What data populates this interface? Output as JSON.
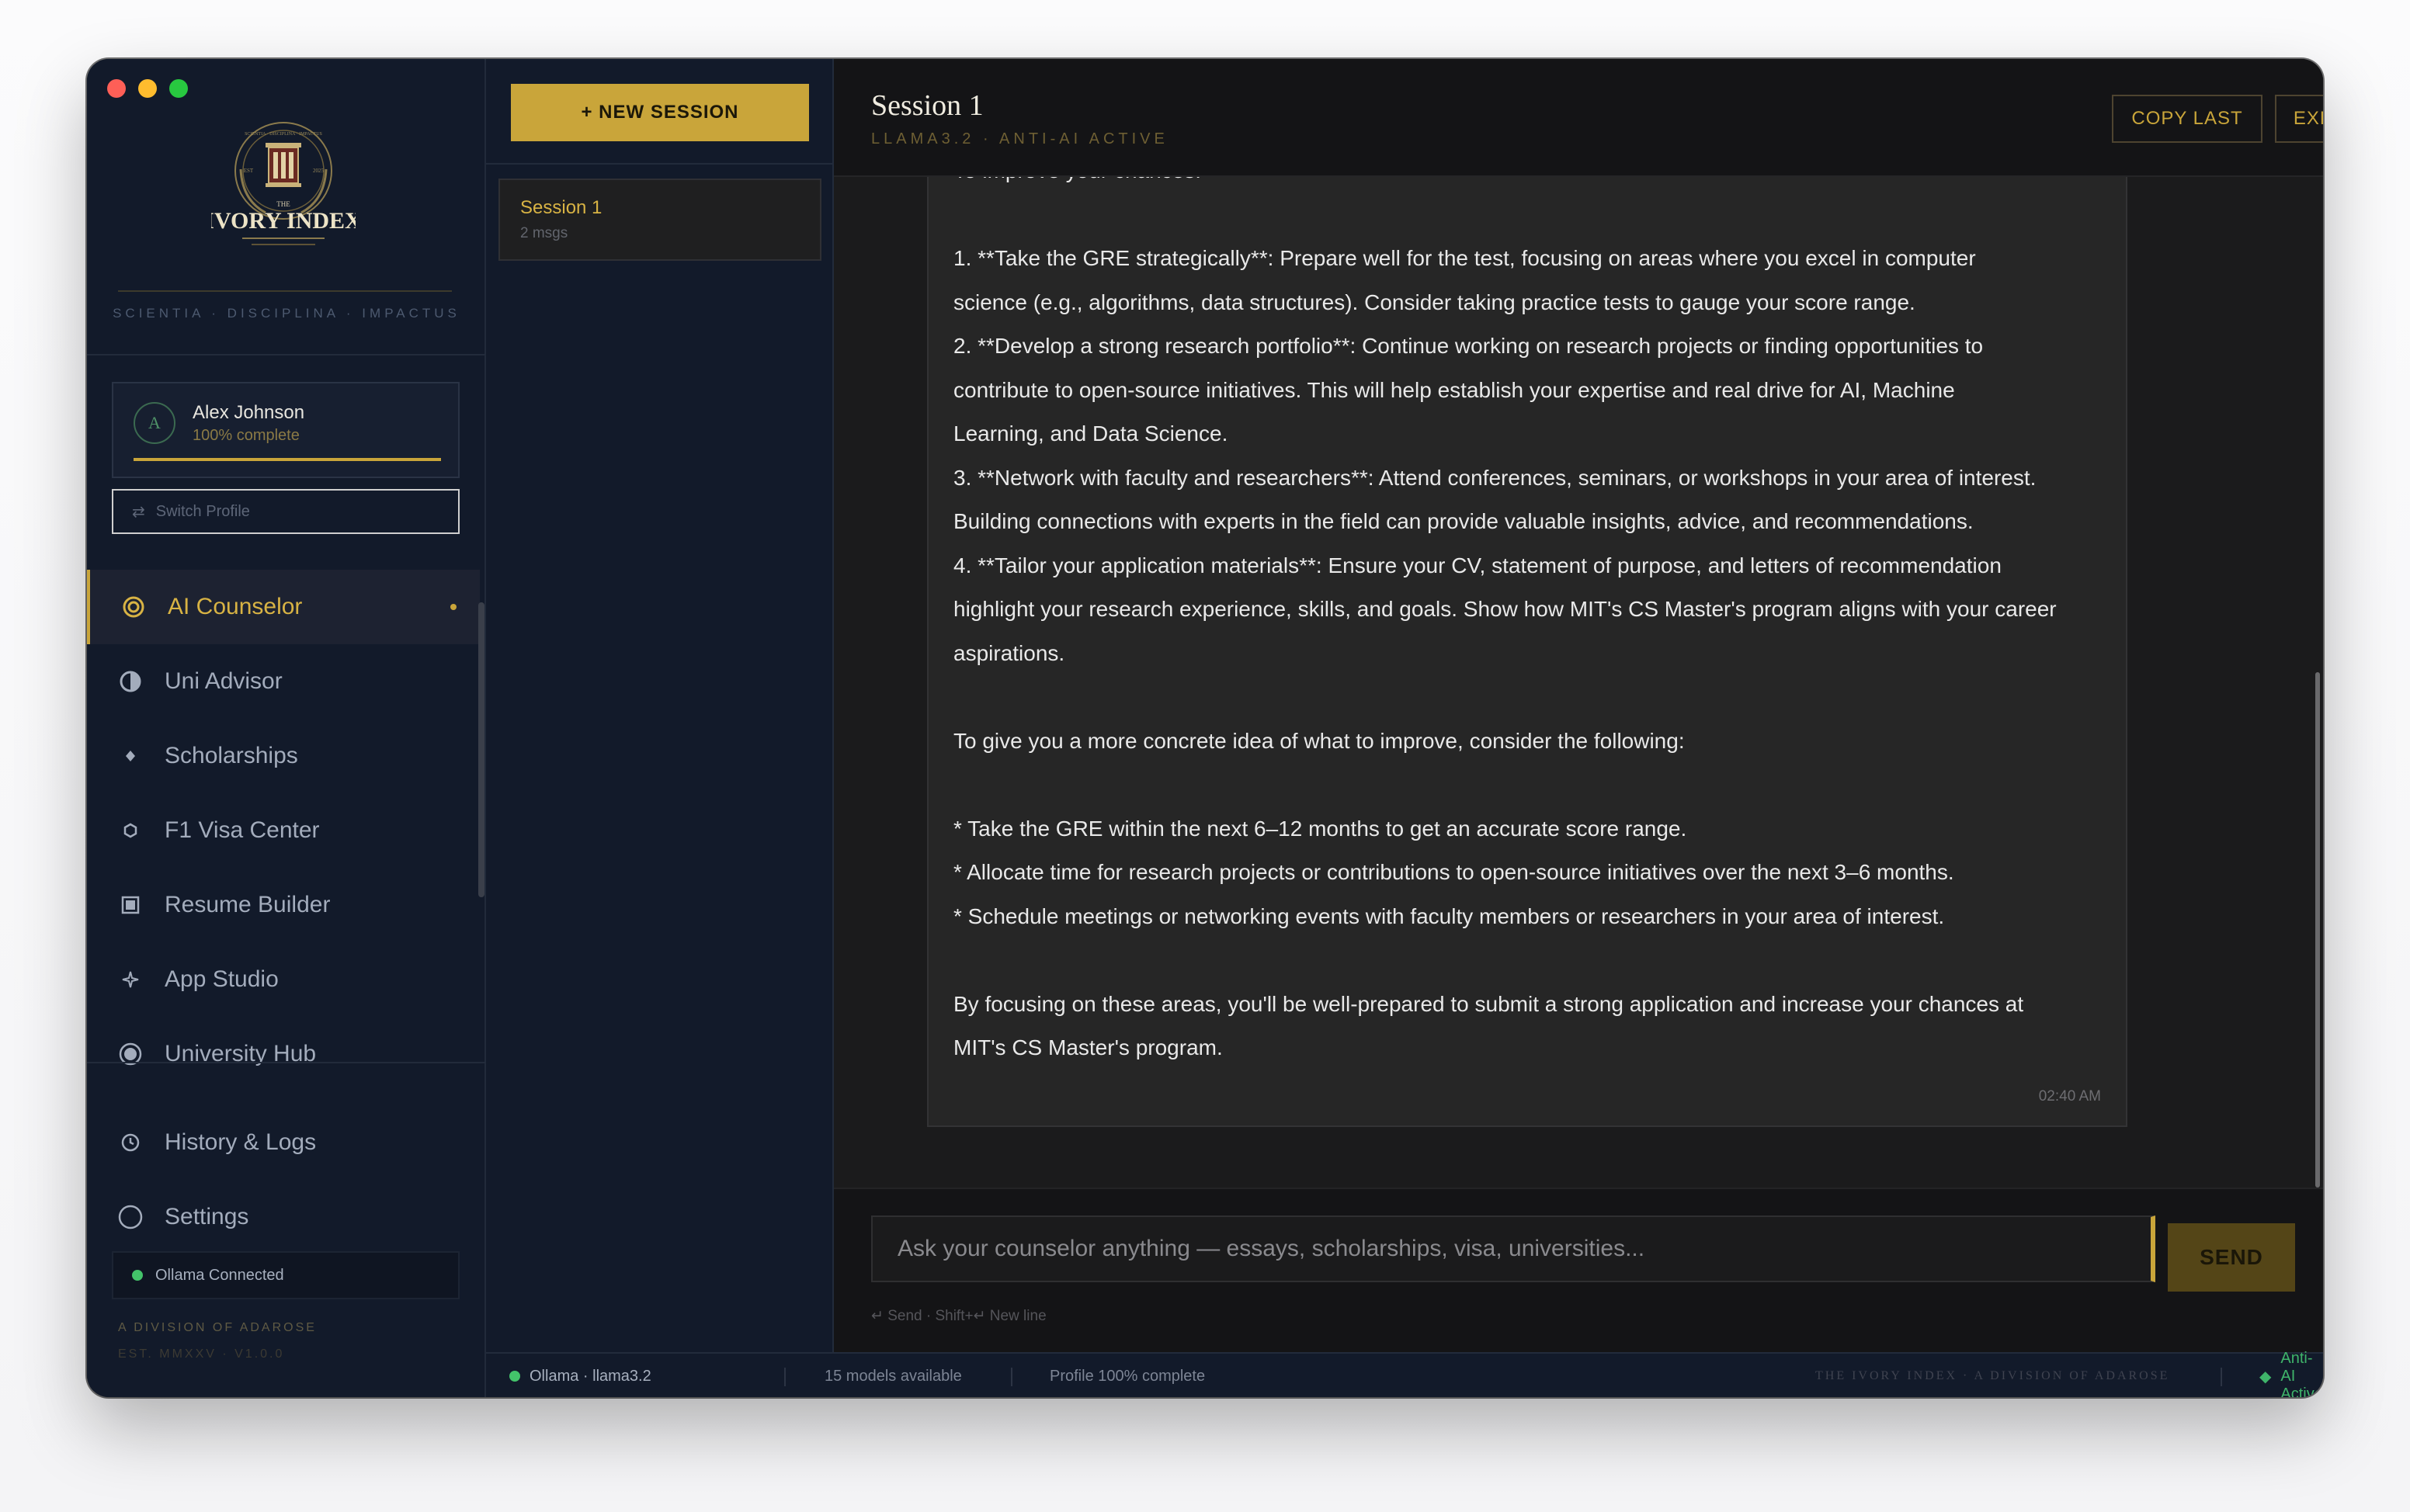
{
  "brand": {
    "logo_top": "SCIENTIA · DISCIPLINA · IMPACTUS",
    "logo_the": "THE",
    "logo_name": "IVORY INDEX",
    "logo_left": "EST",
    "logo_right": "2025",
    "motto": "SCIENTIA · DISCIPLINA · IMPACTUS"
  },
  "profile": {
    "initial": "A",
    "name": "Alex Johnson",
    "completion_text": "100% complete",
    "completion_fraction": 1.0,
    "switch_label": "Switch Profile",
    "switch_icon": "⇄"
  },
  "nav": {
    "items": [
      {
        "label": "AI Counselor",
        "icon": "target-icon",
        "active": true
      },
      {
        "label": "Uni Advisor",
        "icon": "half-circle-icon"
      },
      {
        "label": "Scholarships",
        "icon": "diamond-icon"
      },
      {
        "label": "F1 Visa Center",
        "icon": "hexagon-icon"
      },
      {
        "label": "Resume Builder",
        "icon": "document-icon"
      },
      {
        "label": "App Studio",
        "icon": "sparkle-icon"
      },
      {
        "label": "University Hub",
        "icon": "radio-icon"
      }
    ],
    "secondary": [
      {
        "label": "History & Logs",
        "icon": "clock-icon"
      },
      {
        "label": "Settings",
        "icon": "circle-icon"
      }
    ]
  },
  "connection": {
    "label": "Ollama Connected"
  },
  "footer": {
    "division": "A DIVISION OF ADAROSE",
    "est": "EST. MMXXV · V1.0.0"
  },
  "sessions": {
    "new_label": "+ NEW SESSION",
    "items": [
      {
        "name": "Session 1",
        "count": "2 msgs"
      }
    ]
  },
  "header": {
    "title": "Session 1",
    "subtitle": "LLAMA3.2 · ANTI-AI ACTIVE",
    "copy_label": "COPY LAST",
    "export_label": "EXPORT"
  },
  "message": {
    "lines": [
      "To improve your chances:",
      "",
      "1. **Take the GRE strategically**: Prepare well for the test, focusing on areas where you excel in computer",
      "science (e.g., algorithms, data structures). Consider taking practice tests to gauge your score range.",
      "2. **Develop a strong research portfolio**: Continue working on research projects or finding opportunities to",
      "contribute to open-source initiatives. This will help establish your expertise and real drive for AI, Machine",
      "Learning, and Data Science.",
      "3. **Network with faculty and researchers**: Attend conferences, seminars, or workshops in your area of interest.",
      "Building connections with experts in the field can provide valuable insights, advice, and recommendations.",
      "4. **Tailor your application materials**: Ensure your CV, statement of purpose, and letters of recommendation",
      "highlight your research experience, skills, and goals. Show how MIT's CS Master's program aligns with your career",
      "aspirations.",
      "",
      "To give you a more concrete idea of what to improve, consider the following:",
      "",
      "* Take the GRE within the next 6–12 months to get an accurate score range.",
      "* Allocate time for research projects or contributions to open-source initiatives over the next 3–6 months.",
      "* Schedule meetings or networking events with faculty members or researchers in your area of interest.",
      "",
      "By focusing on these areas, you'll be well-prepared to submit a strong application and increase your chances at",
      "MIT's CS Master's program."
    ],
    "time": "02:40 AM"
  },
  "composer": {
    "placeholder": "Ask your counselor anything — essays, scholarships, visa, universities...",
    "send_label": "SEND",
    "hint": "↵ Send · Shift+↵ New line"
  },
  "statusbar": {
    "model": "Ollama · llama3.2",
    "models": "15 models available",
    "profile": "Profile 100% complete",
    "brand": "THE IVORY INDEX · A DIVISION OF ADAROSE",
    "anti_icon": "◆",
    "anti": "Anti-AI Active"
  },
  "colors": {
    "accent": "#c9a53a",
    "sidebar_bg": "#121a2a",
    "main_bg": "#1b1b1c",
    "status_green": "#43c36a"
  }
}
